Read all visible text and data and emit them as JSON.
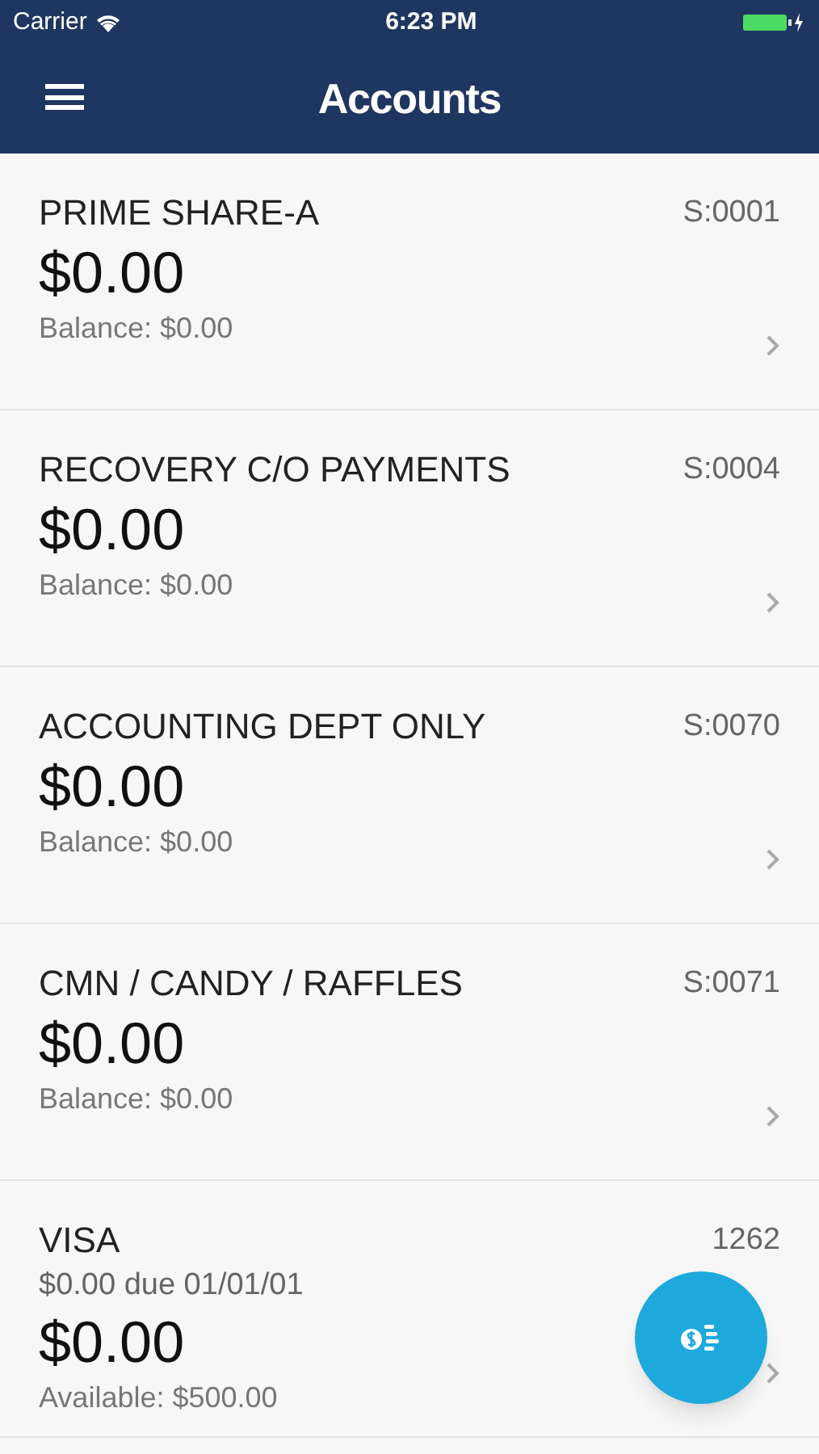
{
  "status_bar": {
    "carrier": "Carrier",
    "time": "6:23 PM"
  },
  "nav": {
    "title": "Accounts"
  },
  "accounts": [
    {
      "name": "PRIME SHARE-A",
      "id": "S:0001",
      "amount": "$0.00",
      "detail": "Balance: $0.00"
    },
    {
      "name": "RECOVERY C/O PAYMENTS",
      "id": "S:0004",
      "amount": "$0.00",
      "detail": "Balance: $0.00"
    },
    {
      "name": "ACCOUNTING DEPT ONLY",
      "id": "S:0070",
      "amount": "$0.00",
      "detail": "Balance: $0.00"
    },
    {
      "name": "CMN / CANDY / RAFFLES",
      "id": "S:0071",
      "amount": "$0.00",
      "detail": "Balance: $0.00"
    },
    {
      "name": "VISA",
      "id": "1262",
      "due": "$0.00 due 01/01/01",
      "amount": "$0.00",
      "detail": "Available: $500.00"
    }
  ]
}
